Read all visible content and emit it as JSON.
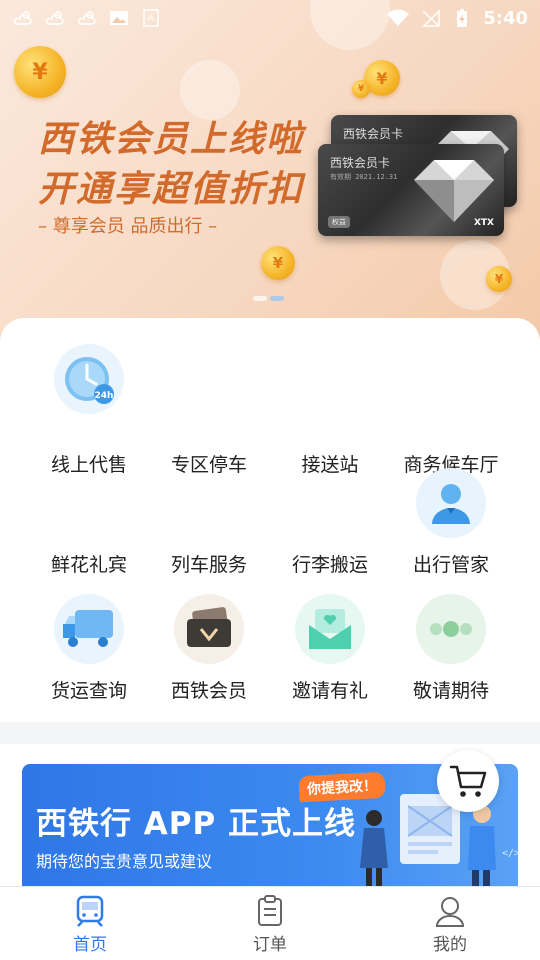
{
  "status_bar": {
    "time": "5:40",
    "left_icons": [
      "cloud-sun-icon",
      "cloud-sun-icon",
      "cloud-sun-icon",
      "image-icon",
      "a-box-icon"
    ],
    "right_icons": [
      "wifi-icon",
      "no-signal-icon",
      "battery-charging-icon"
    ]
  },
  "banner": {
    "headline_1": "西铁会员上线啦",
    "headline_2": "开通享超值折扣",
    "subline": "– 尊享会员  品质出行 –",
    "card_back_title": "西铁会员卡",
    "card_front_title": "西铁会员卡",
    "card_front_date": "有效期 2021.12.31",
    "card_badge": "权益",
    "card_logo": "XTX",
    "coin_symbol": "¥",
    "accent_color": "#d16a2a"
  },
  "services": [
    {
      "label": "线上代售",
      "icon": "clock-24h-icon"
    },
    {
      "label": "专区停车",
      "icon": ""
    },
    {
      "label": "接送站",
      "icon": ""
    },
    {
      "label": "商务候车厅",
      "icon": ""
    },
    {
      "label": "鲜花礼宾",
      "icon": ""
    },
    {
      "label": "列车服务",
      "icon": ""
    },
    {
      "label": "行李搬运",
      "icon": ""
    },
    {
      "label": "出行管家",
      "icon": "butler-person-icon"
    },
    {
      "label": "货运查询",
      "icon": "truck-icon"
    },
    {
      "label": "西铁会员",
      "icon": "member-card-icon"
    },
    {
      "label": "邀请有礼",
      "icon": "invite-envelope-icon"
    },
    {
      "label": "敬请期待",
      "icon": "coming-soon-dots-icon"
    }
  ],
  "promo": {
    "title": "西铁行 APP 正式上线",
    "subtitle": "期待您的宝贵意见或建议",
    "tag": "你提我改！",
    "code_mark": "</>"
  },
  "bottom_nav": {
    "items": [
      {
        "label": "首页",
        "icon": "train-home-icon",
        "active": true
      },
      {
        "label": "订单",
        "icon": "clipboard-orders-icon",
        "active": false
      },
      {
        "label": "我的",
        "icon": "user-profile-icon",
        "active": false
      }
    ],
    "active_color": "#2f7be8"
  }
}
